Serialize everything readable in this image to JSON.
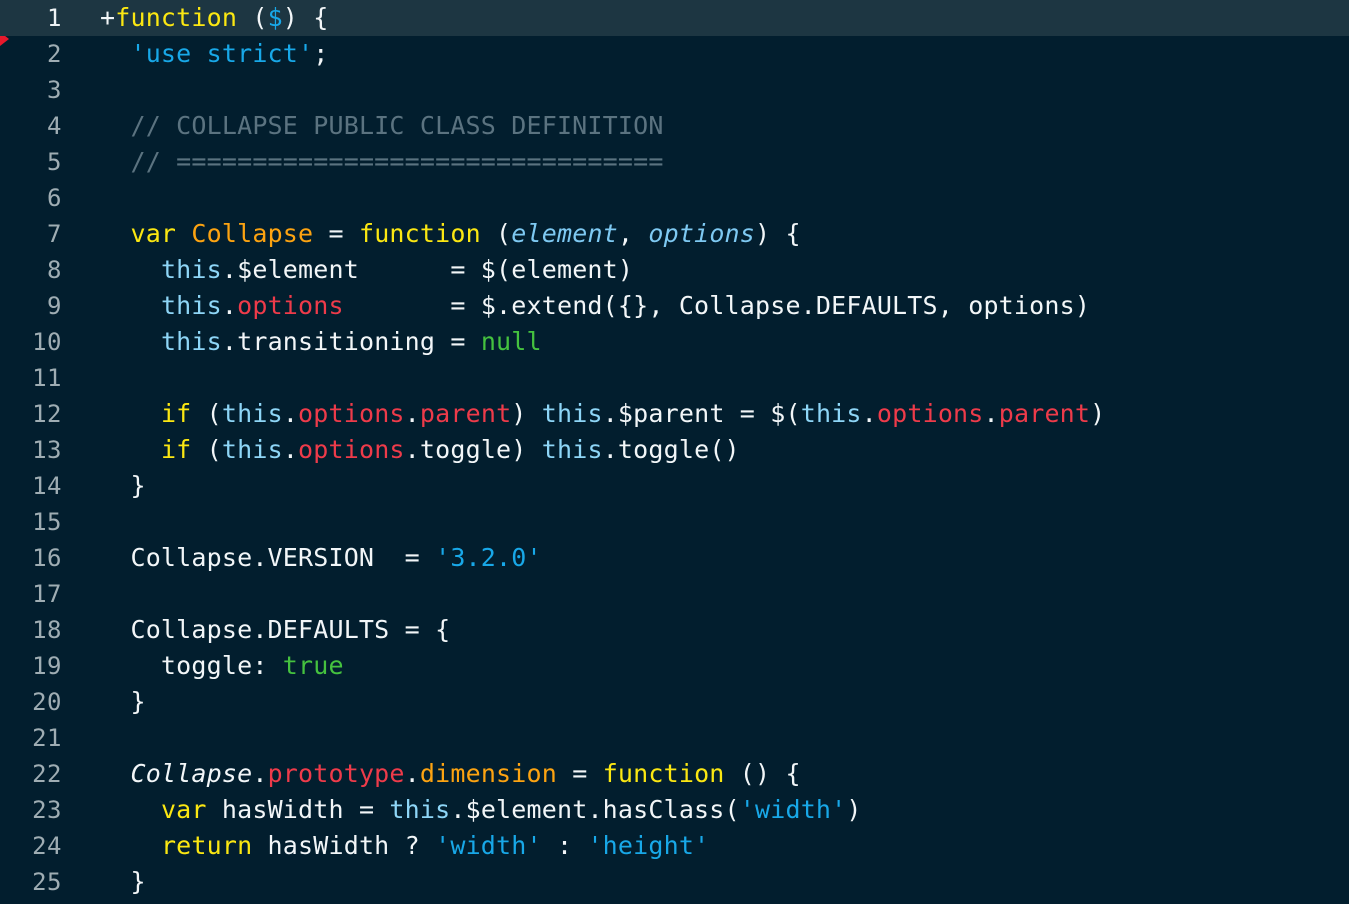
{
  "editor": {
    "theme_colors": {
      "background": "#021e2e",
      "active_line": "#1d3642",
      "gutter_text": "#9fadb3",
      "gutter_text_active": "#eef3f5",
      "default_text": "#f2f6f8",
      "keyword": "#fbe712",
      "class_name": "#fca311",
      "parameter": "#7ec9f2",
      "this_keyword": "#8ed6f7",
      "property": "#ee3b4a",
      "string": "#18a8e8",
      "constant": "#45c23f",
      "comment": "#5b7380",
      "marker": "#e8192c"
    },
    "marker_icon": "change-marker-triangle",
    "active_line_number": 1,
    "first_visible_line": 1,
    "last_visible_line": 25,
    "lines": [
      {
        "number": "1",
        "active": true,
        "tokens": [
          {
            "t": "+",
            "c": "plain"
          },
          {
            "t": "function",
            "c": "kw"
          },
          {
            "t": " (",
            "c": "plain"
          },
          {
            "t": "$",
            "c": "str"
          },
          {
            "t": ") {",
            "c": "plain"
          }
        ]
      },
      {
        "number": "2",
        "active": false,
        "tokens": [
          {
            "t": "  ",
            "c": "plain"
          },
          {
            "t": "'use strict'",
            "c": "str"
          },
          {
            "t": ";",
            "c": "plain"
          }
        ]
      },
      {
        "number": "3",
        "active": false,
        "tokens": []
      },
      {
        "number": "4",
        "active": false,
        "tokens": [
          {
            "t": "  ",
            "c": "plain"
          },
          {
            "t": "// COLLAPSE PUBLIC CLASS DEFINITION",
            "c": "cmt"
          }
        ]
      },
      {
        "number": "5",
        "active": false,
        "tokens": [
          {
            "t": "  ",
            "c": "plain"
          },
          {
            "t": "// ================================",
            "c": "cmt"
          }
        ]
      },
      {
        "number": "6",
        "active": false,
        "tokens": []
      },
      {
        "number": "7",
        "active": false,
        "tokens": [
          {
            "t": "  ",
            "c": "plain"
          },
          {
            "t": "var",
            "c": "kw"
          },
          {
            "t": " ",
            "c": "plain"
          },
          {
            "t": "Collapse",
            "c": "cls"
          },
          {
            "t": " = ",
            "c": "plain"
          },
          {
            "t": "function",
            "c": "kw"
          },
          {
            "t": " (",
            "c": "plain"
          },
          {
            "t": "element",
            "c": "param"
          },
          {
            "t": ", ",
            "c": "plain"
          },
          {
            "t": "options",
            "c": "param"
          },
          {
            "t": ") {",
            "c": "plain"
          }
        ]
      },
      {
        "number": "8",
        "active": false,
        "tokens": [
          {
            "t": "    ",
            "c": "plain"
          },
          {
            "t": "this",
            "c": "this"
          },
          {
            "t": ".$element      = $(element)",
            "c": "plain"
          }
        ]
      },
      {
        "number": "9",
        "active": false,
        "tokens": [
          {
            "t": "    ",
            "c": "plain"
          },
          {
            "t": "this",
            "c": "this"
          },
          {
            "t": ".",
            "c": "plain"
          },
          {
            "t": "options",
            "c": "prop"
          },
          {
            "t": "       = $.extend({}, Collapse.DEFAULTS, options)",
            "c": "plain"
          }
        ]
      },
      {
        "number": "10",
        "active": false,
        "tokens": [
          {
            "t": "    ",
            "c": "plain"
          },
          {
            "t": "this",
            "c": "this"
          },
          {
            "t": ".transitioning = ",
            "c": "plain"
          },
          {
            "t": "null",
            "c": "val"
          }
        ]
      },
      {
        "number": "11",
        "active": false,
        "tokens": []
      },
      {
        "number": "12",
        "active": false,
        "tokens": [
          {
            "t": "    ",
            "c": "plain"
          },
          {
            "t": "if",
            "c": "kw"
          },
          {
            "t": " (",
            "c": "plain"
          },
          {
            "t": "this",
            "c": "this"
          },
          {
            "t": ".",
            "c": "plain"
          },
          {
            "t": "options",
            "c": "prop"
          },
          {
            "t": ".",
            "c": "plain"
          },
          {
            "t": "parent",
            "c": "prop"
          },
          {
            "t": ") ",
            "c": "plain"
          },
          {
            "t": "this",
            "c": "this"
          },
          {
            "t": ".$parent = $(",
            "c": "plain"
          },
          {
            "t": "this",
            "c": "this"
          },
          {
            "t": ".",
            "c": "plain"
          },
          {
            "t": "options",
            "c": "prop"
          },
          {
            "t": ".",
            "c": "plain"
          },
          {
            "t": "parent",
            "c": "prop"
          },
          {
            "t": ")",
            "c": "plain"
          }
        ]
      },
      {
        "number": "13",
        "active": false,
        "tokens": [
          {
            "t": "    ",
            "c": "plain"
          },
          {
            "t": "if",
            "c": "kw"
          },
          {
            "t": " (",
            "c": "plain"
          },
          {
            "t": "this",
            "c": "this"
          },
          {
            "t": ".",
            "c": "plain"
          },
          {
            "t": "options",
            "c": "prop"
          },
          {
            "t": ".toggle) ",
            "c": "plain"
          },
          {
            "t": "this",
            "c": "this"
          },
          {
            "t": ".toggle()",
            "c": "plain"
          }
        ]
      },
      {
        "number": "14",
        "active": false,
        "tokens": [
          {
            "t": "  }",
            "c": "plain"
          }
        ]
      },
      {
        "number": "15",
        "active": false,
        "tokens": []
      },
      {
        "number": "16",
        "active": false,
        "tokens": [
          {
            "t": "  Collapse.VERSION  = ",
            "c": "plain"
          },
          {
            "t": "'3.2.0'",
            "c": "str"
          }
        ]
      },
      {
        "number": "17",
        "active": false,
        "tokens": []
      },
      {
        "number": "18",
        "active": false,
        "tokens": [
          {
            "t": "  Collapse.DEFAULTS = {",
            "c": "plain"
          }
        ]
      },
      {
        "number": "19",
        "active": false,
        "tokens": [
          {
            "t": "    toggle: ",
            "c": "plain"
          },
          {
            "t": "true",
            "c": "val"
          }
        ]
      },
      {
        "number": "20",
        "active": false,
        "tokens": [
          {
            "t": "  }",
            "c": "plain"
          }
        ]
      },
      {
        "number": "21",
        "active": false,
        "tokens": []
      },
      {
        "number": "22",
        "active": false,
        "tokens": [
          {
            "t": "  ",
            "c": "plain"
          },
          {
            "t": "Collapse",
            "c": "clsw"
          },
          {
            "t": ".",
            "c": "plain"
          },
          {
            "t": "prototype",
            "c": "prop"
          },
          {
            "t": ".",
            "c": "plain"
          },
          {
            "t": "dimension",
            "c": "cls"
          },
          {
            "t": " = ",
            "c": "plain"
          },
          {
            "t": "function",
            "c": "kw"
          },
          {
            "t": " () {",
            "c": "plain"
          }
        ]
      },
      {
        "number": "23",
        "active": false,
        "tokens": [
          {
            "t": "    ",
            "c": "plain"
          },
          {
            "t": "var",
            "c": "kw"
          },
          {
            "t": " hasWidth = ",
            "c": "plain"
          },
          {
            "t": "this",
            "c": "this"
          },
          {
            "t": ".$element.hasClass(",
            "c": "plain"
          },
          {
            "t": "'width'",
            "c": "str"
          },
          {
            "t": ")",
            "c": "plain"
          }
        ]
      },
      {
        "number": "24",
        "active": false,
        "tokens": [
          {
            "t": "    ",
            "c": "plain"
          },
          {
            "t": "return",
            "c": "kw"
          },
          {
            "t": " hasWidth ? ",
            "c": "plain"
          },
          {
            "t": "'width'",
            "c": "str"
          },
          {
            "t": " : ",
            "c": "plain"
          },
          {
            "t": "'height'",
            "c": "str"
          }
        ]
      },
      {
        "number": "25",
        "active": false,
        "tokens": [
          {
            "t": "  }",
            "c": "plain"
          }
        ]
      }
    ]
  }
}
